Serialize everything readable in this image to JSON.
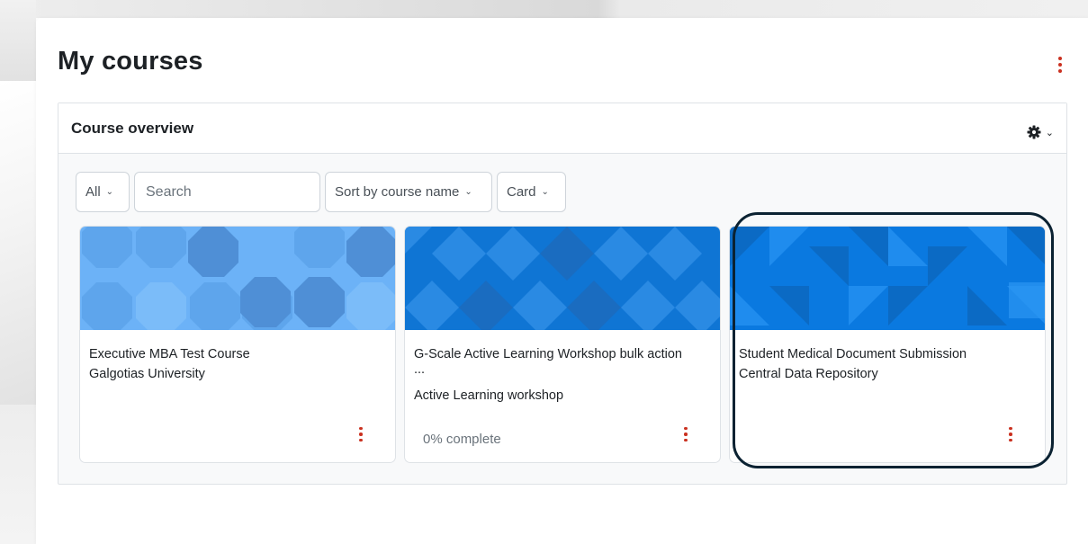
{
  "page": {
    "title": "My courses"
  },
  "block": {
    "title": "Course overview"
  },
  "filters": {
    "grouping_label": "All",
    "search_placeholder": "Search",
    "sort_label": "Sort by course name",
    "view_label": "Card"
  },
  "courses": [
    {
      "name": "Executive MBA Test Course",
      "category": "Galgotias University",
      "progress": ""
    },
    {
      "name": "G-Scale Active Learning Workshop bulk action",
      "name_overflow": "...",
      "category": "Active Learning workshop",
      "progress": "0% complete"
    },
    {
      "name": "Student Medical Document Submission",
      "category": "Central Data Repository",
      "progress": ""
    }
  ],
  "colors": {
    "accent_red": "#ca3120",
    "card1_bg": "#6cb2f7",
    "card2_bg": "#0f75d4",
    "card3_bg": "#0a79e0",
    "highlight_ring": "#0b2232"
  },
  "icons": {
    "page_menu": "kebab-vertical-icon",
    "block_settings": "gear-icon",
    "dropdown": "chevron-down-icon"
  }
}
